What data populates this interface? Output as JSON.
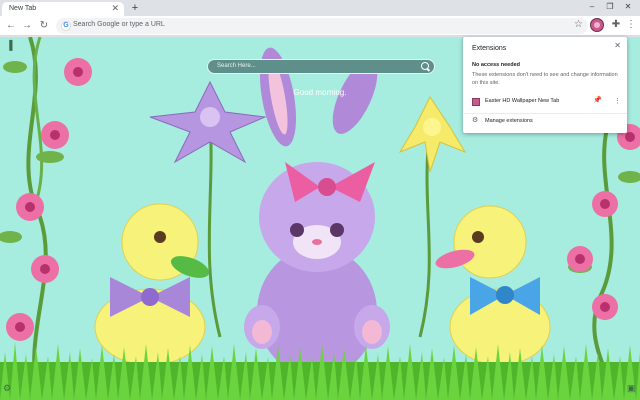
{
  "tab": {
    "title": "New Tab",
    "close": "✕"
  },
  "newtab": "+",
  "window": {
    "minimize": "–",
    "restore": "❐",
    "close": "✕"
  },
  "nav": {
    "back": "←",
    "forward": "→",
    "reload": "↻"
  },
  "omnibox": {
    "placeholder": "Search Google or type a URL",
    "g": "G"
  },
  "page": {
    "search_placeholder": "Search Here...",
    "greeting": "Good morning."
  },
  "popup": {
    "title": "Extensions",
    "close": "✕",
    "subheading": "No access needed",
    "description": "These extensions don't need to see and change information on this site.",
    "extension_name": "Easter HD Wallpaper New Tab",
    "manage": "Manage extensions"
  },
  "colors": {
    "background": "#a6ecdf",
    "grass": "#5cc43a",
    "accent": "#1a73e8",
    "extension": "#c85a8a"
  }
}
